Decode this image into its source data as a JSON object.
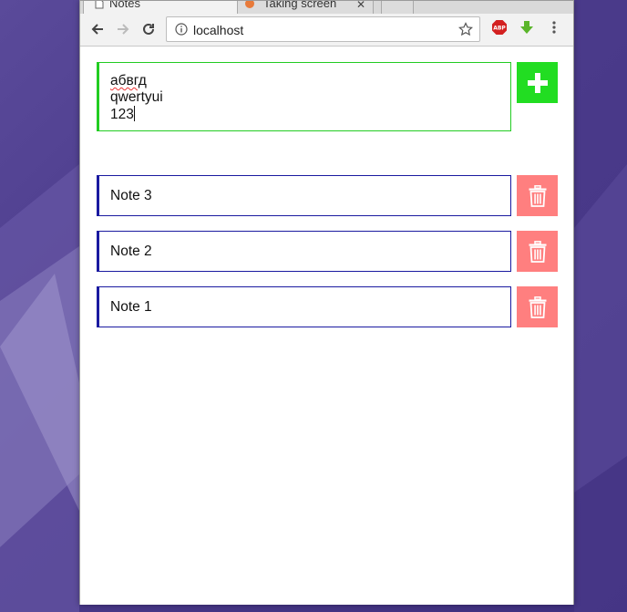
{
  "browser": {
    "tabs": [
      {
        "title": "Notes",
        "active": true
      },
      {
        "title": "Taking screen",
        "active": false
      }
    ],
    "url": "localhost",
    "extensions": [
      "abp-icon",
      "download-arrow-icon"
    ]
  },
  "editor": {
    "lines": [
      "абвгд",
      "qwertyui",
      "123"
    ]
  },
  "notes": [
    {
      "text": "Note 3"
    },
    {
      "text": "Note 2"
    },
    {
      "text": "Note 1"
    }
  ],
  "colors": {
    "editor_border": "#22cc22",
    "add_button": "#22dd22",
    "note_border": "#1a1aa0",
    "delete_button": "#ff7f7f"
  }
}
